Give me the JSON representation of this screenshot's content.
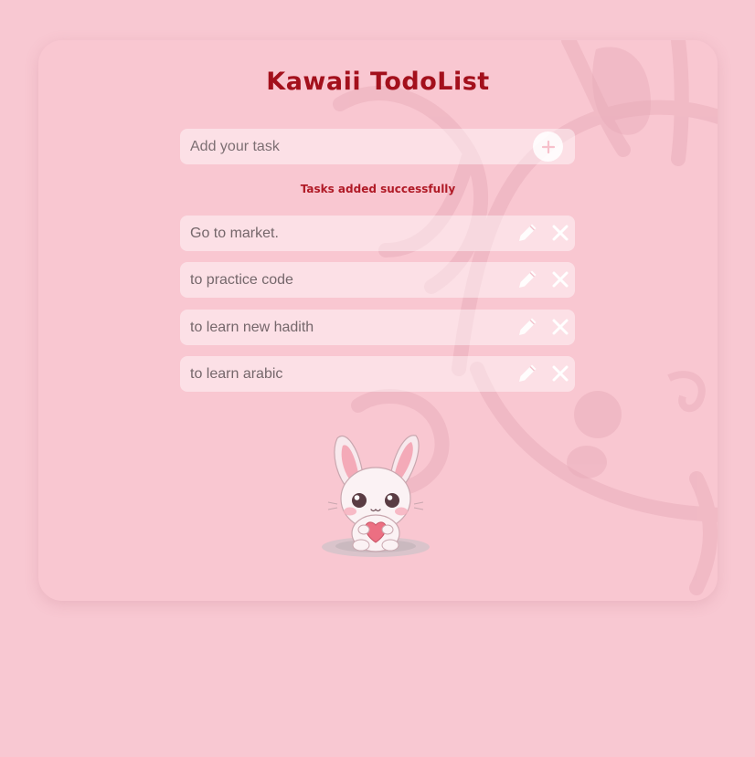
{
  "app": {
    "title": "Kawaii TodoList"
  },
  "input": {
    "placeholder": "Add your task",
    "value": "",
    "add_icon": "plus-icon"
  },
  "status": {
    "message": "Tasks added successfully"
  },
  "tasks": [
    {
      "text": "Go to market."
    },
    {
      "text": "to practice code"
    },
    {
      "text": "to learn new hadith"
    },
    {
      "text": "to learn arabic"
    }
  ],
  "icons": {
    "edit": "pencil-icon",
    "delete": "close-icon",
    "mascot": "bunny-illustration"
  },
  "colors": {
    "page_background": "#f8c8d2",
    "card_background": "#f9c7d1",
    "title": "#a3101c",
    "status": "#b01a26"
  }
}
